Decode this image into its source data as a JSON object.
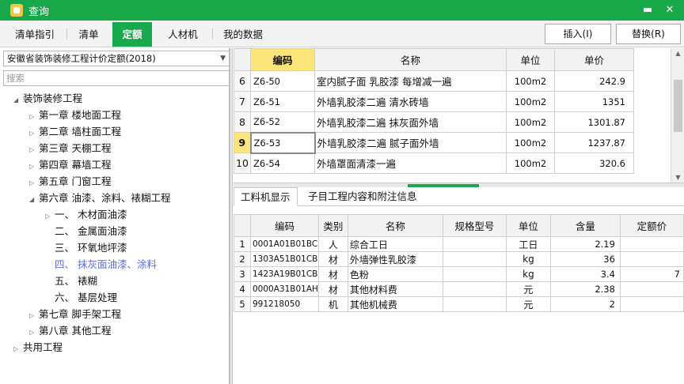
{
  "window": {
    "title": "查询",
    "minimize_glyph": "▬",
    "close_glyph": "✕"
  },
  "tabs": [
    {
      "label": "清单指引"
    },
    {
      "label": "清单"
    },
    {
      "label": "定额",
      "active": true
    },
    {
      "label": "人材机"
    },
    {
      "label": "我的数据"
    }
  ],
  "actions": {
    "insert_label": "插入(I)",
    "replace_label": "替换(R)"
  },
  "left": {
    "dropdown_value": "安徽省装饰装修工程计价定额(2018)",
    "search_placeholder": "搜索",
    "tree": [
      {
        "label": "装饰装修工程",
        "toggle": "◢"
      },
      {
        "label": "第一章 楼地面工程",
        "toggle": "▷"
      },
      {
        "label": "第二章 墙柱面工程",
        "toggle": "▷"
      },
      {
        "label": "第三章 天棚工程",
        "toggle": "▷"
      },
      {
        "label": "第四章 幕墙工程",
        "toggle": "▷"
      },
      {
        "label": "第五章 门窗工程",
        "toggle": "▷"
      },
      {
        "label": "第六章 油漆、涂料、裱糊工程",
        "toggle": "◢"
      },
      {
        "label": "一、 木材面油漆",
        "toggle": "▷"
      },
      {
        "label": "二、 金属面油漆",
        "toggle": ""
      },
      {
        "label": "三、 环氧地坪漆",
        "toggle": ""
      },
      {
        "label": "四、 抹灰面油漆、涂料",
        "toggle": ""
      },
      {
        "label": "五、 裱糊",
        "toggle": ""
      },
      {
        "label": "六、 基层处理",
        "toggle": ""
      },
      {
        "label": "第七章 脚手架工程",
        "toggle": "▷"
      },
      {
        "label": "第八章 其他工程",
        "toggle": "▷"
      },
      {
        "label": "共用工程",
        "toggle": "▷"
      }
    ]
  },
  "quota_grid": {
    "headers": {
      "code": "编码",
      "name": "名称",
      "unit": "单位",
      "price": "单价"
    },
    "rows": [
      {
        "num": "6",
        "code": "Z6-50",
        "name": "室内腻子面 乳胶漆 每增减一遍",
        "unit": "100m2",
        "price": "242.9"
      },
      {
        "num": "7",
        "code": "Z6-51",
        "name": "外墙乳胶漆二遍 清水砖墙",
        "unit": "100m2",
        "price": "1351"
      },
      {
        "num": "8",
        "code": "Z6-52",
        "name": "外墙乳胶漆二遍 抹灰面外墙",
        "unit": "100m2",
        "price": "1301.87"
      },
      {
        "num": "9",
        "code": "Z6-53",
        "name": "外墙乳胶漆二遍 腻子面外墙",
        "unit": "100m2",
        "price": "1237.87"
      },
      {
        "num": "10",
        "code": "Z6-54",
        "name": "外墙罩面清漆一遍",
        "unit": "100m2",
        "price": "320.6"
      }
    ]
  },
  "bottom_tabs": [
    {
      "label": "工料机显示"
    },
    {
      "label": "子目工程内容和附注信息"
    }
  ],
  "resource_grid": {
    "headers": {
      "code": "编码",
      "type": "类别",
      "name": "名称",
      "spec": "规格型号",
      "unit": "单位",
      "qty": "含量",
      "price": "定额价"
    },
    "rows": [
      {
        "num": "1",
        "code": "0001A01B01BC",
        "type": "人",
        "name": "综合工日",
        "spec": "",
        "unit": "工日",
        "qty": "2.19",
        "price": ""
      },
      {
        "num": "2",
        "code": "1303A51B01CB",
        "type": "材",
        "name": "外墙弹性乳胶漆",
        "spec": "",
        "unit": "kg",
        "qty": "36",
        "price": ""
      },
      {
        "num": "3",
        "code": "1423A19B01CB",
        "type": "材",
        "name": "色粉",
        "spec": "",
        "unit": "kg",
        "qty": "3.4",
        "price": "7"
      },
      {
        "num": "4",
        "code": "0000A31B01AH",
        "type": "材",
        "name": "其他材料费",
        "spec": "",
        "unit": "元",
        "qty": "2.38",
        "price": ""
      },
      {
        "num": "5",
        "code": "991218050",
        "type": "机",
        "name": "其他机械费",
        "spec": "",
        "unit": "元",
        "qty": "2",
        "price": ""
      }
    ]
  },
  "colors": {
    "titlebar": "#18a84a",
    "active_tab": "#1aa84e",
    "code_header": "#fbe57a",
    "selected_tree": "#5b6de8"
  }
}
